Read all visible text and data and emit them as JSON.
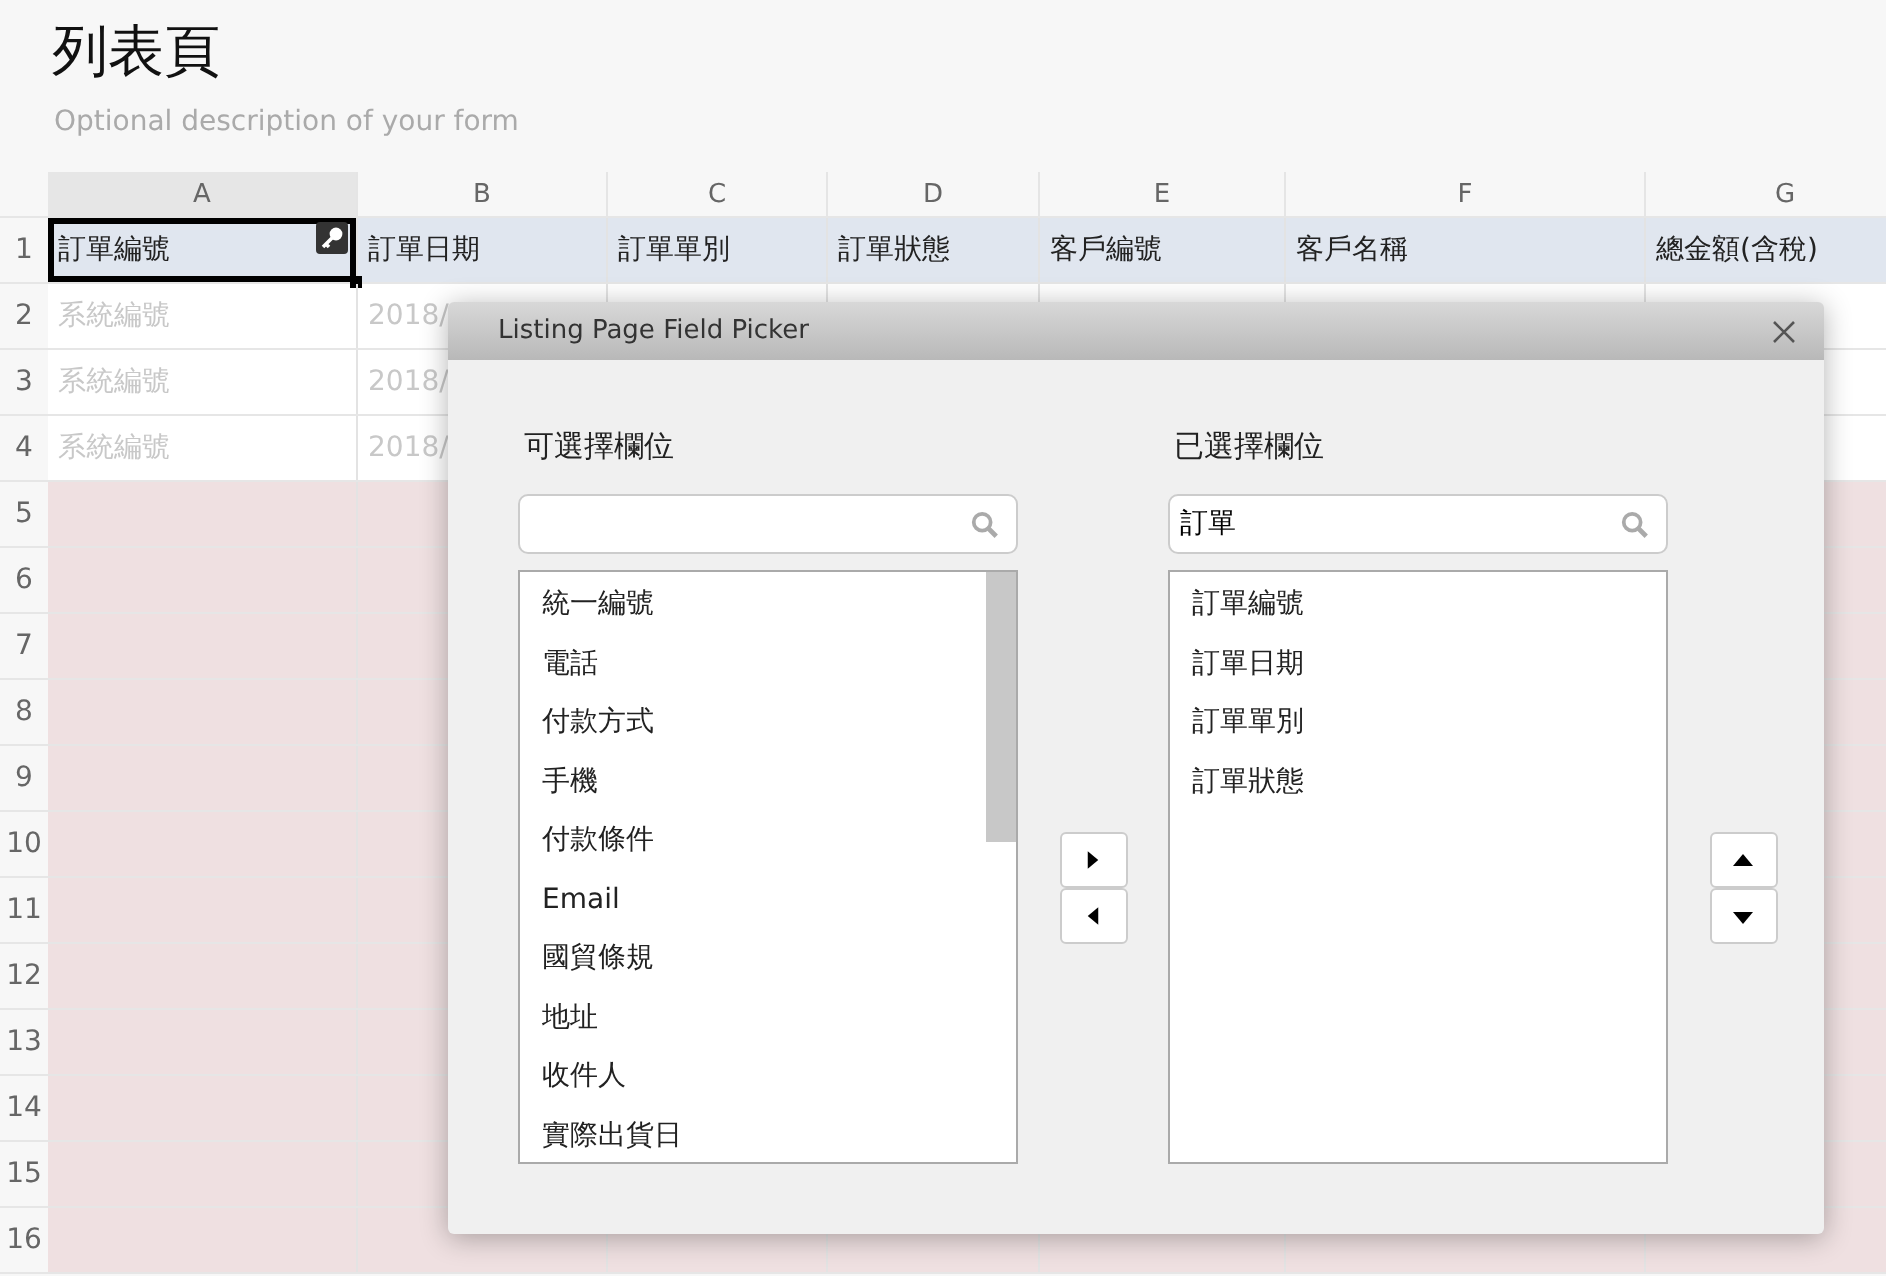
{
  "form": {
    "title": "列表頁",
    "description": "Optional description of your form"
  },
  "sheet": {
    "columns": [
      {
        "letter": "A",
        "selected": true
      },
      {
        "letter": "B",
        "selected": false
      },
      {
        "letter": "C",
        "selected": false
      },
      {
        "letter": "D",
        "selected": false
      },
      {
        "letter": "E",
        "selected": false
      },
      {
        "letter": "F",
        "selected": false
      },
      {
        "letter": "G",
        "selected": false
      }
    ],
    "rows": [
      {
        "number": "1",
        "kind": "header",
        "cells": [
          {
            "text": "訂單編號",
            "selected": true,
            "key": true
          },
          {
            "text": "訂單日期",
            "selected": false,
            "key": false
          },
          {
            "text": "訂單單別",
            "selected": false,
            "key": false
          },
          {
            "text": "訂單狀態",
            "selected": false,
            "key": false
          },
          {
            "text": "客戶編號",
            "selected": false,
            "key": false
          },
          {
            "text": "客戶名稱",
            "selected": false,
            "key": false
          },
          {
            "text": "總金額(含稅)",
            "selected": false,
            "key": false
          }
        ]
      },
      {
        "number": "2",
        "kind": "sample",
        "cells": [
          {
            "text": "系統編號"
          },
          {
            "text": "2018/"
          }
        ]
      },
      {
        "number": "3",
        "kind": "sample",
        "cells": [
          {
            "text": "系統編號"
          },
          {
            "text": "2018/"
          }
        ]
      },
      {
        "number": "4",
        "kind": "sample",
        "cells": [
          {
            "text": "系統編號"
          },
          {
            "text": "2018/"
          }
        ]
      },
      {
        "number": "5",
        "kind": "empty",
        "cells": []
      },
      {
        "number": "6",
        "kind": "empty",
        "cells": []
      },
      {
        "number": "7",
        "kind": "empty",
        "cells": []
      },
      {
        "number": "8",
        "kind": "empty",
        "cells": []
      },
      {
        "number": "9",
        "kind": "empty",
        "cells": []
      },
      {
        "number": "10",
        "kind": "empty",
        "cells": []
      },
      {
        "number": "11",
        "kind": "empty",
        "cells": []
      },
      {
        "number": "12",
        "kind": "empty",
        "cells": []
      },
      {
        "number": "13",
        "kind": "empty",
        "cells": []
      },
      {
        "number": "14",
        "kind": "empty",
        "cells": []
      },
      {
        "number": "15",
        "kind": "empty",
        "cells": []
      },
      {
        "number": "16",
        "kind": "empty",
        "cells": []
      }
    ]
  },
  "dialog": {
    "title": "Listing Page Field Picker",
    "available": {
      "label": "可選擇欄位",
      "items": [
        "統一編號",
        "電話",
        "付款方式",
        "手機",
        "付款條件",
        "Email",
        "國貿條規",
        "地址",
        "收件人",
        "實際出貨日"
      ]
    },
    "chosen": {
      "label": "已選擇欄位",
      "search": "訂單",
      "items": [
        "訂單編號",
        "訂單日期",
        "訂單單別",
        "訂單狀態"
      ]
    }
  }
}
